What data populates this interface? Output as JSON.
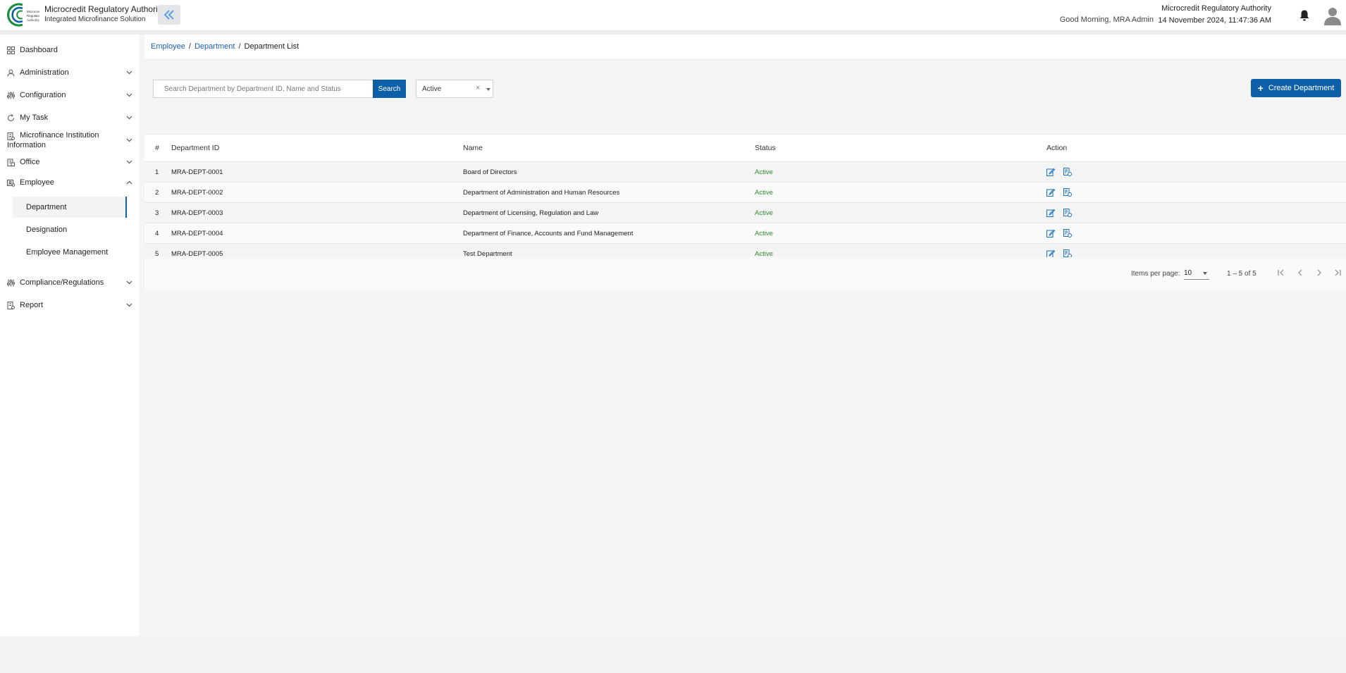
{
  "header": {
    "brand_title": "Microcredit Regulatory Authority",
    "brand_subtitle": "Integrated Microfinance Solution",
    "greeting": "Good Morning, MRA Admin",
    "org_name": "Microcredit Regulatory Authority",
    "datetime": "14 November 2024, 11:47:36 AM",
    "logo_icon": "mra-logo-icon",
    "colors": {
      "primary": "#0d5fa8",
      "accent_green": "#1a8f3c"
    }
  },
  "sidebar": {
    "items": [
      {
        "label": "Dashboard",
        "icon": "grid-icon"
      },
      {
        "label": "Administration",
        "icon": "users-icon"
      },
      {
        "label": "Configuration",
        "icon": "sliders-icon"
      },
      {
        "label": "My Task",
        "icon": "refresh-icon"
      },
      {
        "label": "Microfinance Institution Information",
        "icon": "document-icon"
      },
      {
        "label": "Office",
        "icon": "building-icon"
      },
      {
        "label": "Employee",
        "icon": "id-card-icon"
      },
      {
        "label": "Compliance/Regulations",
        "icon": "sliders-icon"
      },
      {
        "label": "Report",
        "icon": "report-icon"
      }
    ],
    "employee_subitems": [
      {
        "label": "Department"
      },
      {
        "label": "Designation"
      },
      {
        "label": "Employee Management"
      }
    ]
  },
  "breadcrumb": {
    "items": [
      "Employee",
      "Department"
    ],
    "current": "Department List"
  },
  "toolbar": {
    "search_placeholder": "Search Department by Department ID, Name and Status",
    "search_label": "Search",
    "status_value": "Active",
    "clear_glyph": "×",
    "create_label": "Create Department"
  },
  "table": {
    "headers": {
      "num": "#",
      "id": "Department ID",
      "name": "Name",
      "status": "Status",
      "action": "Action"
    },
    "rows": [
      {
        "num": "1",
        "id": "MRA-DEPT-0001",
        "name": "Board of Directors",
        "status": "Active"
      },
      {
        "num": "2",
        "id": "MRA-DEPT-0002",
        "name": "Department of Administration and Human Resources",
        "status": "Active"
      },
      {
        "num": "3",
        "id": "MRA-DEPT-0003",
        "name": "Department of Licensing, Regulation and Law",
        "status": "Active"
      },
      {
        "num": "4",
        "id": "MRA-DEPT-0004",
        "name": "Department of Finance, Accounts and Fund Management",
        "status": "Active"
      },
      {
        "num": "5",
        "id": "MRA-DEPT-0005",
        "name": "Test Department",
        "status": "Active"
      }
    ]
  },
  "pagination": {
    "items_per_page_label": "Items per page:",
    "items_per_page": "10",
    "range": "1 – 5 of 5"
  }
}
